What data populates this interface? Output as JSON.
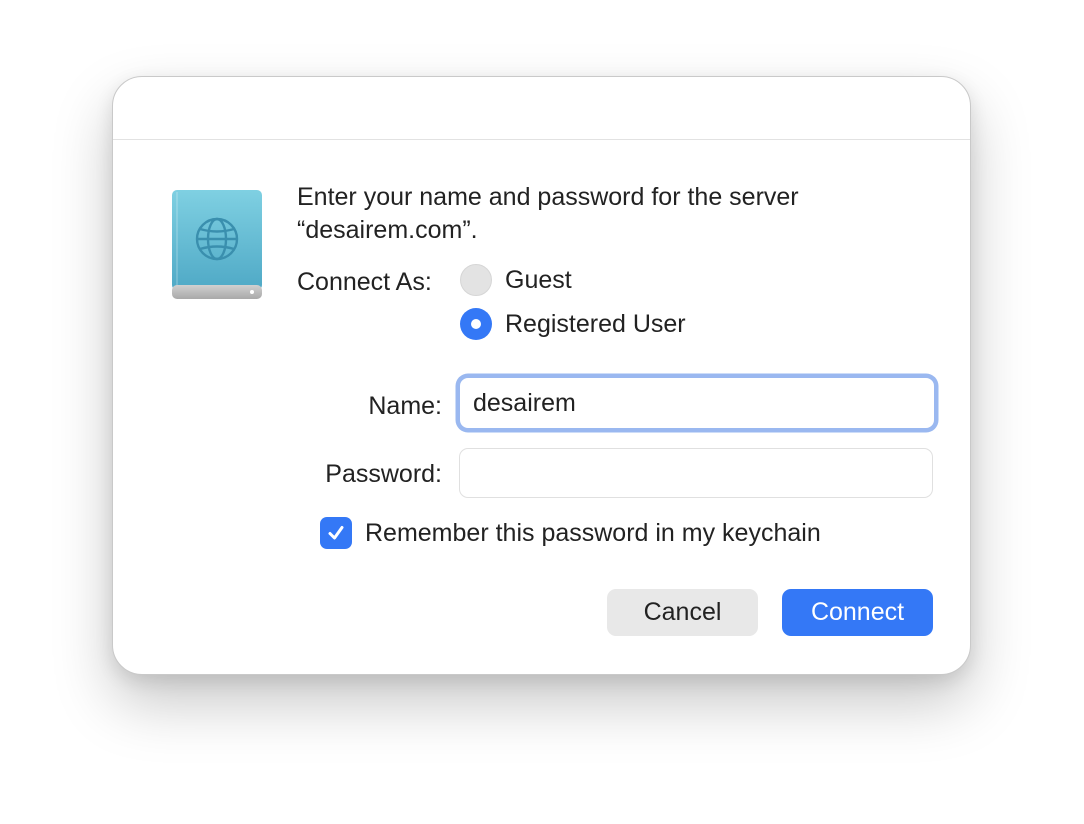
{
  "dialog": {
    "prompt_line1": "Enter your name and password for the server",
    "prompt_line2": "“desairem.com”."
  },
  "connect_as": {
    "label": "Connect As:",
    "options": [
      {
        "label": "Guest",
        "selected": false
      },
      {
        "label": "Registered User",
        "selected": true
      }
    ]
  },
  "name": {
    "label": "Name:",
    "value": "desairem"
  },
  "password": {
    "label": "Password:",
    "value": ""
  },
  "remember": {
    "label": "Remember this password in my keychain",
    "checked": true
  },
  "buttons": {
    "cancel": "Cancel",
    "connect": "Connect"
  },
  "colors": {
    "accent": "#3478f6",
    "server_icon": "#6cc3d8",
    "focus_ring": "#9ab8f0"
  },
  "icons": {
    "server": "network-server-globe-icon",
    "checkmark": "checkmark-icon"
  }
}
